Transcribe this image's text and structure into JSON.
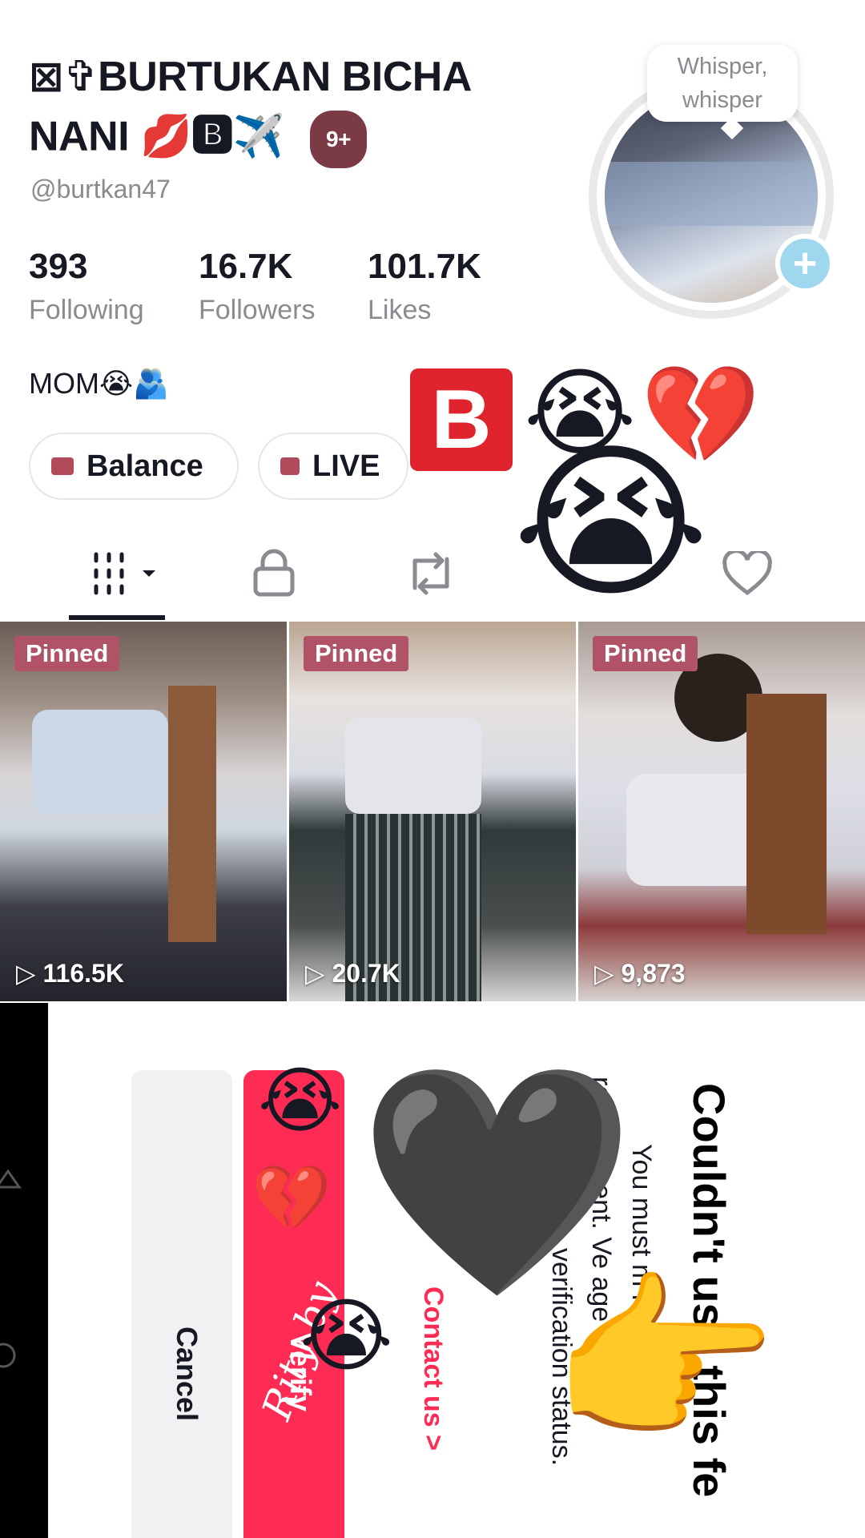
{
  "profile": {
    "name_line1": "⊠✞BURTUKAN BICHA",
    "name_line2": "NANI 💋🅱✈️",
    "notif_badge": "9+",
    "handle": "@burtkan47",
    "bio": "MOM😭🫂",
    "avatar_bubble": "Whisper, whisper",
    "avatar_add": "+"
  },
  "stats": [
    {
      "value": "393",
      "label": "Following"
    },
    {
      "value": "16.7K",
      "label": "Followers"
    },
    {
      "value": "101.7K",
      "label": "Likes"
    }
  ],
  "buttons": {
    "balance": "Balance",
    "live": "LIVE"
  },
  "videos": [
    {
      "pinned": "Pinned",
      "views": "116.5K"
    },
    {
      "pinned": "Pinned",
      "views": "20.7K"
    },
    {
      "pinned": "Pinned",
      "views": "9,873"
    }
  ],
  "overlay_stickers": {
    "b": "🅱️",
    "crying": "😭",
    "broken_heart": "💔",
    "black_heart": "🖤",
    "pointing": "👉"
  },
  "dialog": {
    "title": "Couldn't use this fe",
    "body_line1": "You must m         minimum",
    "body_line2": "requirement. Ve           age or c",
    "body_line3": "verification status.",
    "contact": "Contact us >",
    "verify": "Verify",
    "cancel": "Cancel",
    "signature": "Rity by"
  },
  "colors": {
    "accent": "#fe2c55",
    "pin": "#b05366",
    "badge": "#7a3a46"
  }
}
